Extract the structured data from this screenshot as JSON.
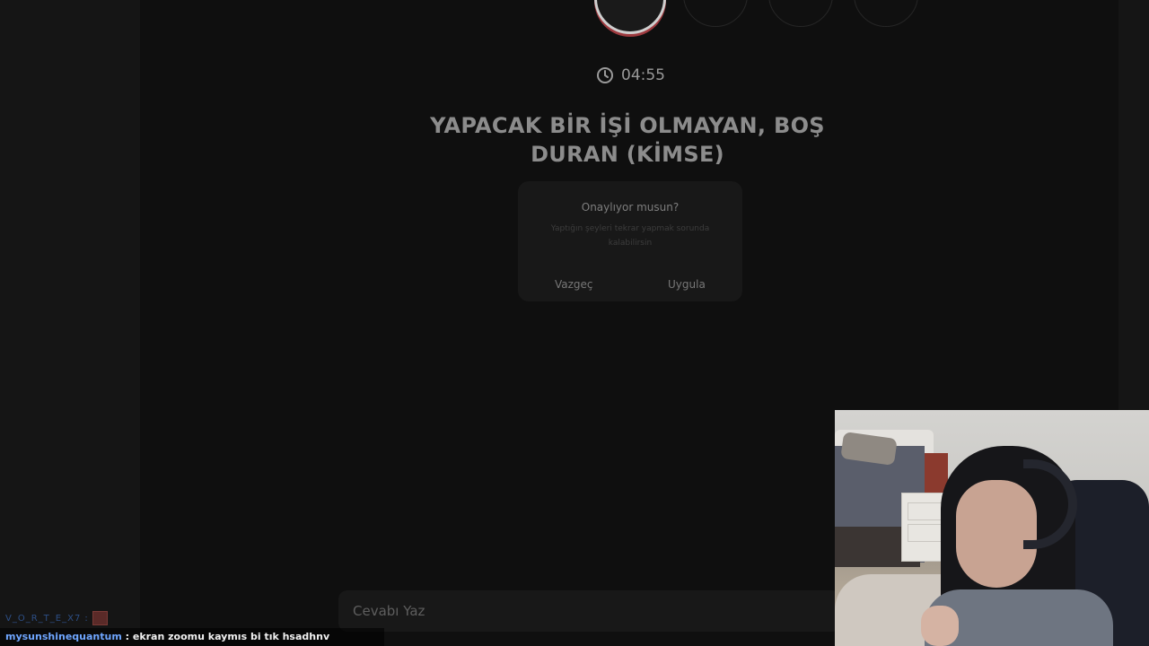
{
  "game": {
    "steps": [
      {
        "label": "★",
        "active": true
      },
      {
        "label": "•",
        "active": false
      },
      {
        "label": "•",
        "active": false
      },
      {
        "label": "+",
        "active": false
      }
    ],
    "timer": "04:55",
    "question": "YAPACAK BİR İŞİ OLMAYAN, BOŞ DURAN (KİMSE)",
    "answer_placeholder": "Cevabı Yaz"
  },
  "dialog": {
    "title": "Onaylıyor musun?",
    "body": "Yaptığın şeyleri tekrar yapmak sorunda kalabilirsin",
    "cancel_label": "Vazgeç",
    "apply_label": "Uygula"
  },
  "chat": {
    "line1_user": "V_O_R_T_E_X7",
    "line1_sep": ":",
    "line2_user": "mysunshinequantum",
    "line2_message": " : ekran zoomu kaymıs bi tık hsadhnv"
  },
  "colors": {
    "accent_ring": "#9e3a3f",
    "chat_user": "#6fa6ff"
  }
}
